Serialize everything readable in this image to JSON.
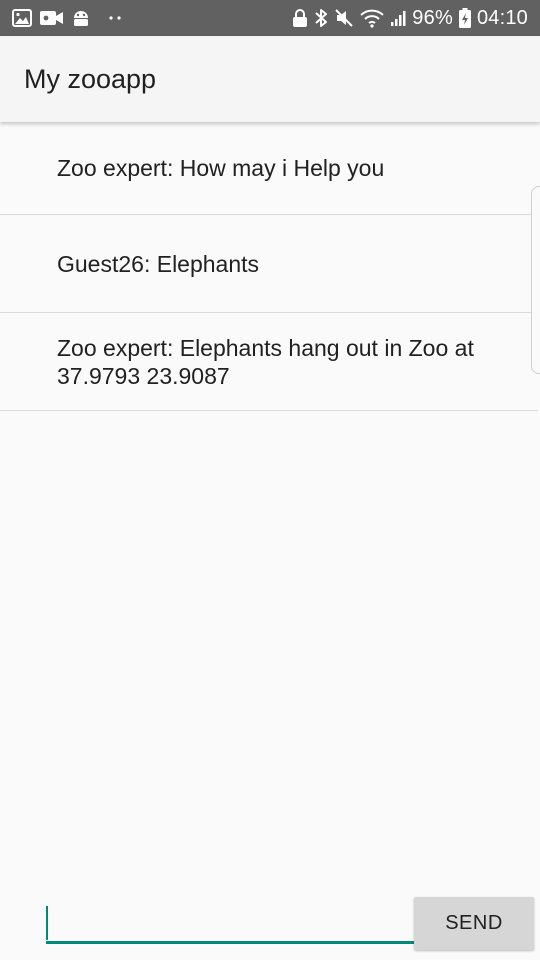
{
  "status_bar": {
    "battery_percent": "96%",
    "time": "04:10",
    "left_icons": [
      "image-icon",
      "video-camera-icon",
      "android-icon",
      "more-dots-icon"
    ],
    "right_icons": [
      "lock-icon",
      "bluetooth-icon",
      "mute-icon",
      "wifi-icon",
      "signal-icon",
      "battery-charging-icon"
    ]
  },
  "app_bar": {
    "title": "My zooapp"
  },
  "messages": [
    {
      "text": "Zoo expert: How may i Help you"
    },
    {
      "text": "Guest26: Elephants"
    },
    {
      "text": "Zoo expert: Elephants hang out in Zoo at 37.9793 23.9087"
    }
  ],
  "composer": {
    "input_value": "",
    "send_label": "SEND"
  },
  "colors": {
    "status_bar": "#616161",
    "app_bar": "#f5f5f5",
    "accent": "#00897b",
    "send_button": "#d6d6d6"
  }
}
